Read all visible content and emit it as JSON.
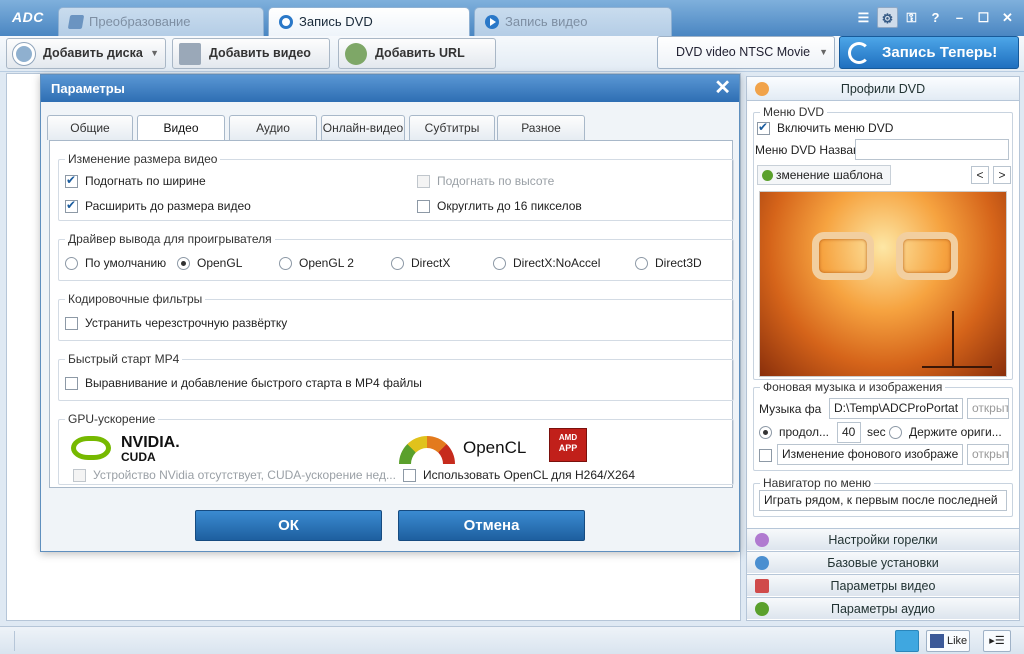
{
  "app": {
    "logo": "ADC",
    "tabs": [
      {
        "label": "Преобразование"
      },
      {
        "label": "Запись DVD"
      },
      {
        "label": "Запись видео"
      }
    ]
  },
  "toolbar": {
    "add_disc": "Добавить диска",
    "add_video": "Добавить видео",
    "add_url": "Добавить URL",
    "format_select": "DVD video NTSC Movie",
    "burn_now": "Запись Теперь!"
  },
  "dialog": {
    "title": "Параметры",
    "tabs": [
      "Общие",
      "Видео",
      "Аудио",
      "Онлайн-видео",
      "Субтитры",
      "Разное"
    ],
    "resize": {
      "title": "Изменение размера видео",
      "fit_width": "Подогнать по ширине",
      "fit_height": "Подогнать по высоте",
      "expand": "Расширить до размера видео",
      "round16": "Округлить до 16 пикселов"
    },
    "driver": {
      "title": "Драйвер вывода для проигрывателя",
      "options": [
        "По умолчанию",
        "OpenGL",
        "OpenGL 2",
        "DirectX",
        "DirectX:NoAccel",
        "Direct3D"
      ]
    },
    "filters": {
      "title": "Кодировочные фильтры",
      "deinterlace": "Устранить черезстрочную развёртку"
    },
    "mp4": {
      "title": "Быстрый старт MP4",
      "option": "Выравнивание и добавление быстрого старта в MP4 файлы"
    },
    "gpu": {
      "title": "GPU-ускорение",
      "nvidia_word": "NVIDIA.",
      "cuda_word": "CUDA",
      "opencl_word": "OpenCL",
      "amd_word": "AMD",
      "amd_app": "APP",
      "nvidia_note": "Устройство NVidia отсутствует, CUDA-ускорение нед...",
      "opencl_option": "Использовать OpenCL для H264/X264"
    },
    "ok": "ОК",
    "cancel": "Отмена"
  },
  "right_panel": {
    "header": "Профили DVD",
    "menu_group": "Меню DVD",
    "enable_menu": "Включить меню DVD",
    "menu_name_label": "Меню DVD Назван",
    "menu_name_value": "",
    "change_template": "зменение шаблона",
    "music_group": "Фоновая музыка и изображения",
    "music_label": "Музыка фа",
    "music_path": "D:\\Temp\\ADCProPortat",
    "open_btn": "открыто",
    "duration_label": "продол...",
    "duration_value": "40",
    "sec": "sec",
    "keep_orig": "Держите ориги...",
    "change_bg": "Изменение фонового изображе",
    "open_btn2": "открыто",
    "nav_group": "Навигатор по меню",
    "nav_value": "Играть рядом, к первым после последней",
    "sections": [
      "Настройки горелки",
      "Базовые установки",
      "Параметры видео",
      "Параметры аудио"
    ]
  },
  "statusbar": {
    "like": "Like"
  },
  "colors": {
    "accent": "#2e6eb3",
    "burn": "#1f6fbf",
    "nvidia_green": "#76b900",
    "amd_red": "#c1201a"
  }
}
